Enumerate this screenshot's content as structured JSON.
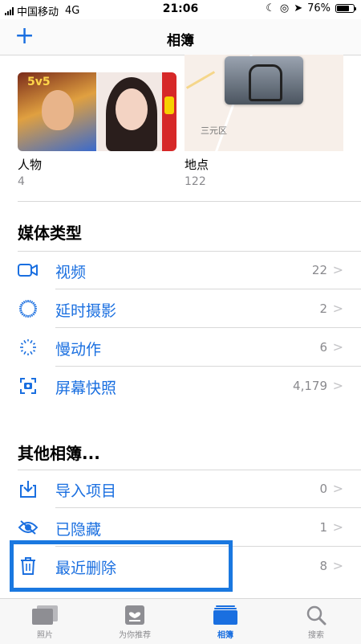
{
  "status_bar": {
    "carrier": "中国移动",
    "network": "4G",
    "time": "21:06",
    "battery": "76%",
    "battery_level": 0.76
  },
  "nav": {
    "title": "相簿",
    "add_icon": "plus-icon"
  },
  "albums": {
    "people": {
      "label": "人物",
      "count": "4"
    },
    "places": {
      "label": "地点",
      "count": "122",
      "map_text": "三元区"
    }
  },
  "media_types": {
    "header": "媒体类型",
    "items": [
      {
        "label": "视频",
        "count": "22",
        "icon": "video-camera-icon"
      },
      {
        "label": "延时摄影",
        "count": "2",
        "icon": "timelapse-icon"
      },
      {
        "label": "慢动作",
        "count": "6",
        "icon": "slow-motion-icon"
      },
      {
        "label": "屏幕快照",
        "count": "4,179",
        "icon": "screenshot-icon"
      }
    ]
  },
  "other_albums": {
    "header": "其他相簿...",
    "items": [
      {
        "label": "导入项目",
        "count": "0",
        "icon": "import-icon"
      },
      {
        "label": "已隐藏",
        "count": "1",
        "icon": "hidden-eye-icon"
      },
      {
        "label": "最近删除",
        "count": "8",
        "icon": "trash-icon"
      }
    ]
  },
  "tab_bar": {
    "tabs": [
      {
        "label": "照片",
        "icon": "photos-icon",
        "active": false
      },
      {
        "label": "为你推荐",
        "icon": "for-you-icon",
        "active": false
      },
      {
        "label": "相簿",
        "icon": "albums-icon",
        "active": true
      },
      {
        "label": "搜索",
        "icon": "search-icon",
        "active": false
      }
    ]
  },
  "colors": {
    "accent": "#1a6fe0",
    "highlight_border": "#1a78e0",
    "secondary_text": "#8a8a8e"
  }
}
